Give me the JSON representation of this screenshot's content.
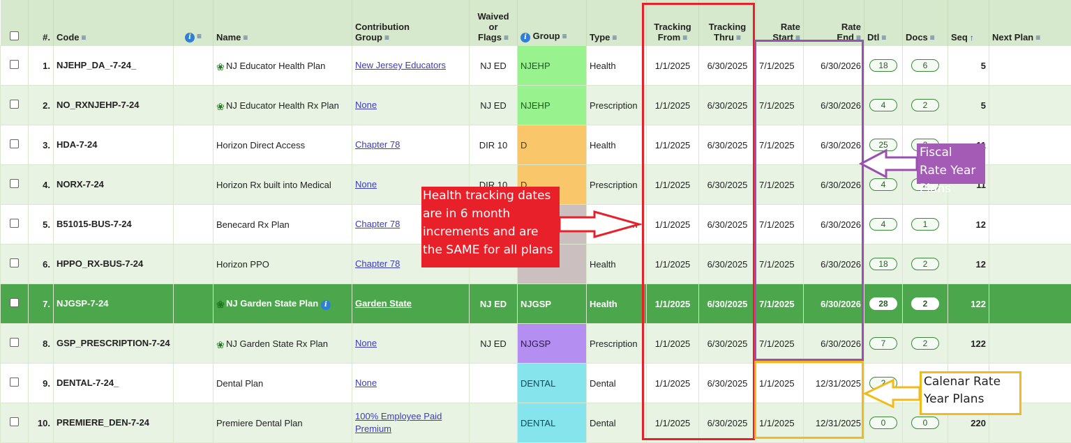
{
  "headers": {
    "num": "#.",
    "code": "Code",
    "name": "Name",
    "contribution": [
      "Contribution",
      "Group"
    ],
    "waived": [
      "Waived",
      "or",
      "Flags"
    ],
    "group": "Group",
    "type": "Type",
    "tracking_from": [
      "Tracking",
      "From"
    ],
    "tracking_thru": [
      "Tracking",
      "Thru"
    ],
    "rate_start": [
      "Rate",
      "Start"
    ],
    "rate_end": [
      "Rate",
      "End"
    ],
    "dtl": "Dtl",
    "docs": "Docs",
    "seq": "Seq",
    "next_plan": "Next Plan"
  },
  "icons": {
    "sort": "≡",
    "sort_asc": "↑",
    "info": "i"
  },
  "rows": [
    {
      "n": "1.",
      "code": "NJEHP_DA_-7-24_",
      "name": "NJ Educator Health Plan",
      "nj": true,
      "contrib": "New Jersey Educators",
      "flags": "NJ ED",
      "group": "NJEHP",
      "group_color": "#98f38f",
      "type": "Health",
      "tf": "1/1/2025",
      "tt": "6/30/2025",
      "rs": "7/1/2025",
      "re": "6/30/2026",
      "dtl": "18",
      "docs": "6",
      "seq": "5"
    },
    {
      "n": "2.",
      "code": "NO_RXNJEHP-7-24",
      "name": "NJ Educator Health Rx Plan",
      "nj": true,
      "contrib": "None",
      "flags": "NJ ED",
      "group": "NJEHP",
      "group_color": "#98f38f",
      "type": "Prescription",
      "tf": "1/1/2025",
      "tt": "6/30/2025",
      "rs": "7/1/2025",
      "re": "6/30/2026",
      "dtl": "4",
      "docs": "2",
      "seq": "5"
    },
    {
      "n": "3.",
      "code": "HDA-7-24",
      "name": "Horizon Direct Access",
      "nj": false,
      "contrib": "Chapter 78",
      "flags": "DIR 10",
      "group": "D",
      "group_color": "#f9c66a",
      "type": "Health",
      "tf": "1/1/2025",
      "tt": "6/30/2025",
      "rs": "7/1/2025",
      "re": "6/30/2026",
      "dtl": "25",
      "docs": "2",
      "seq": "11"
    },
    {
      "n": "4.",
      "code": "NORX-7-24",
      "name": "Horizon Rx built into Medical",
      "nj": false,
      "contrib": "None",
      "flags": "DIR 10",
      "group": "D",
      "group_color": "#f9c66a",
      "type": "Prescription",
      "tf": "1/1/2025",
      "tt": "6/30/2025",
      "rs": "7/1/2025",
      "re": "6/30/2026",
      "dtl": "4",
      "docs": "2",
      "seq": "11"
    },
    {
      "n": "5.",
      "code": "B51015-BUS-7-24",
      "name": "Benecard Rx Plan",
      "nj": false,
      "contrib": "Chapter 78",
      "flags": "",
      "group": "",
      "group_color": "#cbbfbf",
      "type": "Prescription",
      "tf": "1/1/2025",
      "tt": "6/30/2025",
      "rs": "7/1/2025",
      "re": "6/30/2026",
      "dtl": "4",
      "docs": "1",
      "seq": "12"
    },
    {
      "n": "6.",
      "code": "HPPO_RX-BUS-7-24",
      "name": "Horizon PPO",
      "nj": false,
      "contrib": "Chapter 78",
      "flags": "",
      "group": "",
      "group_color": "#cbbfbf",
      "type": "Health",
      "tf": "1/1/2025",
      "tt": "6/30/2025",
      "rs": "7/1/2025",
      "re": "6/30/2026",
      "dtl": "18",
      "docs": "2",
      "seq": "12"
    },
    {
      "n": "7.",
      "code": "NJGSP-7-24",
      "name": "NJ Garden State Plan",
      "nj": true,
      "info": true,
      "contrib": "Garden State",
      "flags": "NJ ED",
      "group": "NJGSP",
      "group_color": "#b48ef0",
      "type": "Health",
      "tf": "1/1/2025",
      "tt": "6/30/2025",
      "rs": "7/1/2025",
      "re": "6/30/2026",
      "dtl": "28",
      "docs": "2",
      "seq": "122",
      "selected": true
    },
    {
      "n": "8.",
      "code": "GSP_PRESCRIPTION-7-24",
      "name": "NJ Garden State Rx Plan",
      "nj": true,
      "contrib": "None",
      "flags": "NJ ED",
      "group": "NJGSP",
      "group_color": "#b48ef0",
      "type": "Prescription",
      "tf": "1/1/2025",
      "tt": "6/30/2025",
      "rs": "7/1/2025",
      "re": "6/30/2026",
      "dtl": "7",
      "docs": "2",
      "seq": "122"
    },
    {
      "n": "9.",
      "code": "DENTAL-7-24_",
      "name": "Dental Plan",
      "nj": false,
      "contrib": "None",
      "flags": "",
      "group": "DENTAL",
      "group_color": "#86e4ed",
      "type": "Dental",
      "tf": "1/1/2025",
      "tt": "6/30/2025",
      "rs": "1/1/2025",
      "re": "12/31/2025",
      "dtl": "2",
      "docs": "",
      "seq": ""
    },
    {
      "n": "10.",
      "code": "PREMIERE_DEN-7-24",
      "name": "Premiere Dental Plan",
      "nj": false,
      "contrib": "100% Employee Paid Premium",
      "flags": "",
      "group": "DENTAL",
      "group_color": "#86e4ed",
      "type": "Dental",
      "tf": "1/1/2025",
      "tt": "6/30/2025",
      "rs": "1/1/2025",
      "re": "12/31/2025",
      "dtl": "0",
      "docs": "0",
      "seq": "220"
    }
  ],
  "annotations": {
    "tracking_note": "Health tracking dates are in 6 month increments and are the SAME for all plans",
    "fiscal_note": "Fiscal Rate Year Plans",
    "calendar_note": "Calenar Rate Year Plans",
    "colors": {
      "red": "#e8202a",
      "purple": "#9b4fb0",
      "yellow": "#f2bb1c"
    }
  }
}
